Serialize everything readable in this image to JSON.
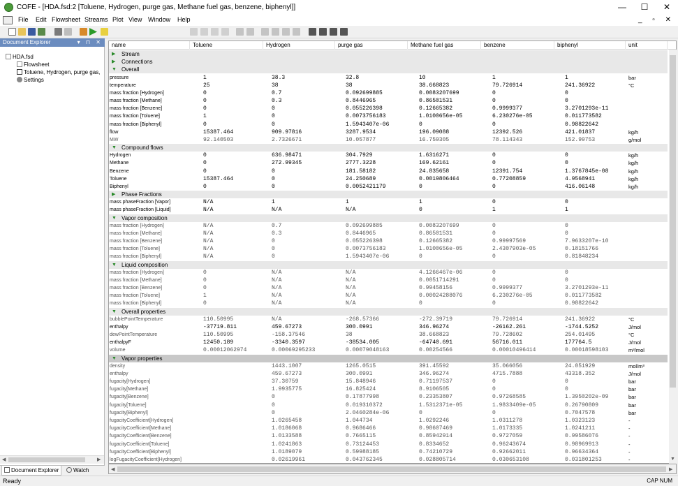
{
  "window": {
    "title": "COFE - [HDA.fsd:2 [Toluene, Hydrogen, purge gas, Methane fuel gas, benzene, biphenyl]]",
    "minimize": "—",
    "maximize": "☐",
    "close": "✕"
  },
  "menu": [
    "File",
    "Edit",
    "Flowsheet",
    "Streams",
    "Plot",
    "View",
    "Window",
    "Help"
  ],
  "mdi_controls": "_ ▫ ✕",
  "toolbar": {
    "view_combo": "default"
  },
  "explorer": {
    "title": "Document Explorer",
    "header_buttons": "▾ ⊓ ✕",
    "tree": [
      "HDA.fsd",
      "Flowsheet",
      "Toluene, Hydrogen, purge gas,",
      "Settings"
    ],
    "tabs": [
      "Document Explorer",
      "Watch"
    ]
  },
  "grid": {
    "columns": [
      "name",
      "Toluene",
      "Hydrogen",
      "purge gas",
      "Methane fuel gas",
      "benzene",
      "biphenyl",
      "unit"
    ],
    "rows": [
      {
        "type": "section",
        "label": "Stream",
        "expanded": false
      },
      {
        "type": "section",
        "label": "Connections",
        "expanded": false
      },
      {
        "type": "section",
        "label": "Overall",
        "expanded": true
      },
      {
        "name": "pressure",
        "v": [
          "1",
          "38.3",
          "32.8",
          "10",
          "1",
          "1"
        ],
        "unit": "bar"
      },
      {
        "name": "temperature",
        "v": [
          "25",
          "38",
          "38",
          "38.668823",
          "79.726914",
          "241.36922"
        ],
        "unit": "°C"
      },
      {
        "name": "mass fraction [Hydrogen]",
        "v": [
          "0",
          "0.7",
          "0.092699885",
          "0.0083207699",
          "0",
          "0"
        ],
        "unit": ""
      },
      {
        "name": "mass fraction [Methane]",
        "v": [
          "0",
          "0.3",
          "0.8446965",
          "0.86501531",
          "0",
          "0"
        ],
        "unit": ""
      },
      {
        "name": "mass fraction [Benzene]",
        "v": [
          "0",
          "0",
          "0.055226398",
          "0.12665382",
          "0.9999377",
          "3.2701293e-11"
        ],
        "unit": ""
      },
      {
        "name": "mass fraction [Toluene]",
        "v": [
          "1",
          "0",
          "0.0073756183",
          "1.0100656e-05",
          "6.230276e-05",
          "0.011773582"
        ],
        "unit": ""
      },
      {
        "name": "mass fraction [Biphenyl]",
        "v": [
          "0",
          "0",
          "1.5943407e-06",
          "0",
          "0",
          "0.98822642"
        ],
        "unit": ""
      },
      {
        "name": "flow",
        "v": [
          "15387.464",
          "909.97816",
          "3287.9534",
          "196.09088",
          "12392.526",
          "421.01837"
        ],
        "unit": "kg/h"
      },
      {
        "name": "MW",
        "v": [
          "92.140503",
          "2.7326671",
          "10.057877",
          "16.759305",
          "78.114343",
          "152.99753"
        ],
        "unit": "g/mol",
        "gray": true
      },
      {
        "type": "section",
        "label": "Compound flows",
        "expanded": true
      },
      {
        "name": "Hydrogen",
        "v": [
          "0",
          "636.98471",
          "304.7929",
          "1.6316271",
          "0",
          "0"
        ],
        "unit": "kg/h"
      },
      {
        "name": "Methane",
        "v": [
          "0",
          "272.99345",
          "2777.3228",
          "169.62161",
          "0",
          "0"
        ],
        "unit": "kg/h"
      },
      {
        "name": "Benzene",
        "v": [
          "0",
          "0",
          "181.58182",
          "24.835658",
          "12391.754",
          "1.3767845e-08"
        ],
        "unit": "kg/h"
      },
      {
        "name": "Toluene",
        "v": [
          "15387.464",
          "0",
          "24.250689",
          "0.0019806464",
          "0.77208859",
          "4.9568941"
        ],
        "unit": "kg/h"
      },
      {
        "name": "Biphenyl",
        "v": [
          "0",
          "0",
          "0.0052421179",
          "0",
          "0",
          "416.06148"
        ],
        "unit": "kg/h"
      },
      {
        "type": "section",
        "label": "Phase Fractions",
        "expanded": false
      },
      {
        "name": "mass phaseFraction [Vapor]",
        "v": [
          "N/A",
          "1",
          "1",
          "1",
          "0",
          "0"
        ],
        "unit": ""
      },
      {
        "name": "mass phaseFraction [Liquid]",
        "v": [
          "N/A",
          "N/A",
          "N/A",
          "0",
          "1",
          "1"
        ],
        "unit": ""
      },
      {
        "type": "section",
        "label": "Vapor composition",
        "expanded": true
      },
      {
        "name": "mass fraction [Hydrogen]",
        "v": [
          "N/A",
          "0.7",
          "0.092699885",
          "0.0083207699",
          "0",
          "0"
        ],
        "unit": "",
        "gray": true
      },
      {
        "name": "mass fraction [Methane]",
        "v": [
          "N/A",
          "0.3",
          "0.8446965",
          "0.86501531",
          "0",
          "0"
        ],
        "unit": "",
        "gray": true
      },
      {
        "name": "mass fraction [Benzene]",
        "v": [
          "N/A",
          "0",
          "0.055226398",
          "0.12665382",
          "0.99997569",
          "7.9633207e-10"
        ],
        "unit": "",
        "gray": true
      },
      {
        "name": "mass fraction [Toluene]",
        "v": [
          "N/A",
          "0",
          "0.0073756183",
          "1.0100656e-05",
          "2.4307903e-05",
          "0.18151766"
        ],
        "unit": "",
        "gray": true
      },
      {
        "name": "mass fraction [Biphenyl]",
        "v": [
          "N/A",
          "0",
          "1.5943407e-06",
          "0",
          "0",
          "0.81848234"
        ],
        "unit": "",
        "gray": true
      },
      {
        "type": "section",
        "label": "Liquid composition",
        "expanded": true
      },
      {
        "name": "mass fraction [Hydrogen]",
        "v": [
          "0",
          "N/A",
          "N/A",
          "4.1266467e-06",
          "0",
          "0"
        ],
        "unit": "",
        "gray": true
      },
      {
        "name": "mass fraction [Methane]",
        "v": [
          "0",
          "N/A",
          "N/A",
          "0.0051714291",
          "0",
          "0"
        ],
        "unit": "",
        "gray": true
      },
      {
        "name": "mass fraction [Benzene]",
        "v": [
          "0",
          "N/A",
          "N/A",
          "0.99458156",
          "0.9999377",
          "3.2701293e-11"
        ],
        "unit": "",
        "gray": true
      },
      {
        "name": "mass fraction [Toluene]",
        "v": [
          "1",
          "N/A",
          "N/A",
          "0.00024288076",
          "6.230276e-05",
          "0.011773582"
        ],
        "unit": "",
        "gray": true
      },
      {
        "name": "mass fraction [Biphenyl]",
        "v": [
          "0",
          "N/A",
          "N/A",
          "0",
          "0",
          "0.98822642"
        ],
        "unit": "",
        "gray": true
      },
      {
        "type": "section",
        "label": "Overall properties",
        "expanded": true
      },
      {
        "name": "bubblePointTemperature",
        "v": [
          "110.50995",
          "N/A",
          "-268.57366",
          "-272.39719",
          "79.726914",
          "241.36922"
        ],
        "unit": "°C",
        "gray": true
      },
      {
        "name": "enthalpy",
        "v": [
          "-37719.811",
          "459.67273",
          "300.0991",
          "346.96274",
          "-26162.261",
          "-1744.5252"
        ],
        "unit": "J/mol"
      },
      {
        "name": "dewPointTemperature",
        "v": [
          "110.50995",
          "-158.37546",
          "38",
          "38.668823",
          "79.728602",
          "254.01495"
        ],
        "unit": "°C",
        "gray": true
      },
      {
        "name": "enthalpyF",
        "v": [
          "12450.189",
          "-3340.3597",
          "-38534.005",
          "-64740.691",
          "56716.011",
          "177764.5"
        ],
        "unit": "J/mol"
      },
      {
        "name": "volume",
        "v": [
          "0.00012062974",
          "0.00069295233",
          "0.00079048163",
          "0.00254566",
          "0.00010496414",
          "0.00018598103"
        ],
        "unit": "m³/mol",
        "gray": true
      },
      {
        "type": "section",
        "label": "Vapor properties",
        "expanded": true,
        "selected": true
      },
      {
        "name": "density",
        "v": [
          "",
          "1443.1007",
          "1265.0515",
          "391.45592",
          "35.066056",
          "24.051929"
        ],
        "unit": "mol/m³",
        "gray": true
      },
      {
        "name": "enthalpy",
        "v": [
          "",
          "459.67273",
          "300.0991",
          "346.96274",
          "4715.7888",
          "43318.352"
        ],
        "unit": "J/mol",
        "gray": true
      },
      {
        "name": "fugacity[Hydrogen]",
        "v": [
          "",
          "37.30759",
          "15.848946",
          "0.71197537",
          "0",
          "0"
        ],
        "unit": "bar",
        "gray": true
      },
      {
        "name": "fugacity[Methane]",
        "v": [
          "",
          "1.9935775",
          "16.825424",
          "8.9106505",
          "0",
          "0"
        ],
        "unit": "bar",
        "gray": true
      },
      {
        "name": "fugacity[Benzene]",
        "v": [
          "",
          "0",
          "0.17877998",
          "0.23353807",
          "0.97268585",
          "1.3950202e-09"
        ],
        "unit": "bar",
        "gray": true
      },
      {
        "name": "fugacity[Toluene]",
        "v": [
          "",
          "0",
          "0.019310372",
          "1.5312371e-05",
          "1.9833409e-05",
          "0.26790809"
        ],
        "unit": "bar",
        "gray": true
      },
      {
        "name": "fugacity[Biphenyl]",
        "v": [
          "",
          "0",
          "2.0460284e-06",
          "0",
          "0",
          "0.7047578"
        ],
        "unit": "bar",
        "gray": true
      },
      {
        "name": "fugacityCoefficient[Hydrogen]",
        "v": [
          "",
          "1.0265458",
          "1.044734",
          "1.0292246",
          "1.0311278",
          "1.0323123"
        ],
        "unit": "-",
        "gray": true
      },
      {
        "name": "fugacityCoefficient[Methane]",
        "v": [
          "",
          "1.0186068",
          "0.9686466",
          "0.98607469",
          "1.0173335",
          "1.0241211"
        ],
        "unit": "-",
        "gray": true
      },
      {
        "name": "fugacityCoefficient[Benzene]",
        "v": [
          "",
          "1.0133588",
          "0.7665115",
          "0.85942914",
          "0.9727059",
          "0.99586076"
        ],
        "unit": "-",
        "gray": true
      },
      {
        "name": "fugacityCoefficient[Toluene]",
        "v": [
          "",
          "1.0241863",
          "0.73124453",
          "0.8334652",
          "0.96243674",
          "0.98969913"
        ],
        "unit": "-",
        "gray": true
      },
      {
        "name": "fugacityCoefficient[Biphenyl]",
        "v": [
          "",
          "1.0189079",
          "0.59988185",
          "0.74210729",
          "0.92662011",
          "0.96634364"
        ],
        "unit": "-",
        "gray": true
      },
      {
        "name": "logFugacityCoefficient[Hydrogen]",
        "v": [
          "",
          "0.02619961",
          "0.043762345",
          "0.028805714",
          "0.030653108",
          "0.031801253"
        ],
        "unit": "-",
        "gray": true
      }
    ]
  },
  "status": {
    "text": "Ready",
    "indicators": "CAP  NUM"
  }
}
